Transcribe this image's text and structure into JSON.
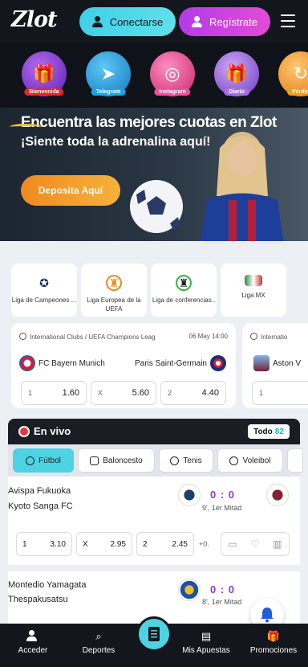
{
  "header": {
    "logo": "Zlot",
    "connect_label": "Conectarse",
    "register_label": "Regístrate"
  },
  "promos": [
    {
      "label": "Bienvenida",
      "color": "#7a2bd6",
      "label_color": "#e02727",
      "icon": "gift-icon"
    },
    {
      "label": "Telegram",
      "color": "#1ea3e2",
      "label_color": "#1ea3e2",
      "icon": "telegram-icon"
    },
    {
      "label": "Instagram",
      "color": "#e94f9a",
      "label_color": "#e94f9a",
      "icon": "instagram-icon"
    },
    {
      "label": "Diario",
      "color": "#a56fe5",
      "label_color": "#a56fe5",
      "icon": "daily-gift-icon"
    },
    {
      "label": "Pérdid",
      "color": "#f49a1f",
      "label_color": "#f49a1f",
      "icon": "cashback-icon"
    }
  ],
  "hero": {
    "line1": "Encuentra las mejores cuotas en Zlot",
    "line2": "¡Siente toda la adrenalina aquí!",
    "deposit_label": "Deposita Aquí"
  },
  "leagues": [
    {
      "name": "Liga de Campeones ...",
      "icon": "champions-league-icon"
    },
    {
      "name": "Liga Europea de la UEFA",
      "icon": "europa-league-icon"
    },
    {
      "name": "Liga de conferencias..",
      "icon": "conference-league-icon"
    },
    {
      "name": "Liga MX",
      "icon": "liga-mx-icon"
    }
  ],
  "featured_matches": [
    {
      "competition": "International Clubs / UEFA Champions Leag",
      "date": "06 May 14:00",
      "home": "FC Bayern Munich",
      "away": "Paris Saint-Germain",
      "odds": [
        {
          "k": "1",
          "v": "1.60"
        },
        {
          "k": "X",
          "v": "5.60"
        },
        {
          "k": "2",
          "v": "4.40"
        }
      ]
    },
    {
      "competition": "Internatio",
      "home": "Aston V",
      "odds": [
        {
          "k": "1",
          "v": ""
        }
      ]
    }
  ],
  "live": {
    "title": "En vivo",
    "all_label": "Todo",
    "all_count": "82",
    "tabs": [
      "Fútbol",
      "Baloncesto",
      "Tenis",
      "Voleibol"
    ],
    "matches": [
      {
        "home": "Avispa Fukuoka",
        "away": "Kyoto Sanga FC",
        "score": "0 : 0",
        "time": "9', 1er Mitad",
        "odds": [
          {
            "k": "1",
            "v": "3.10"
          },
          {
            "k": "X",
            "v": "2.95"
          },
          {
            "k": "2",
            "v": "2.45"
          }
        ],
        "more": "+0."
      },
      {
        "home": "Montedio Yamagata",
        "away": "Thespakusatsu",
        "score": "0 : 0",
        "time": "8', 1er Mitad"
      }
    ]
  },
  "bottom_nav": {
    "login": "Acceder",
    "sports": "Deportes",
    "my_bets": "Mis Apuestas",
    "promotions": "Promociones"
  },
  "colors": {
    "accent": "#4dd3e2",
    "register": "#c441e0",
    "header_bg": "#14161d",
    "score": "#8a3bd0",
    "deposit": "#f08a1e"
  }
}
